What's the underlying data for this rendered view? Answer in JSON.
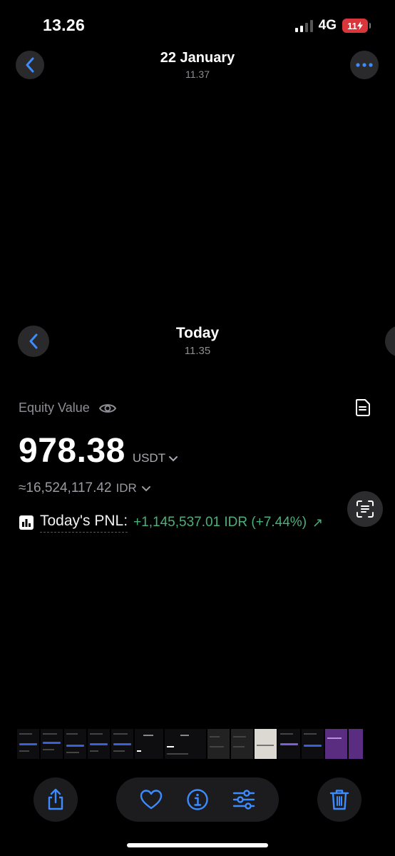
{
  "status": {
    "time": "13.26",
    "network": "4G",
    "battery": "11"
  },
  "nav": {
    "title": "22 January",
    "subtitle": "11.37"
  },
  "screenshot": {
    "title": "Today",
    "subtitle": "11.35",
    "equity_label": "Equity Value",
    "equity_value": "978.38",
    "equity_unit": "USDT",
    "idr_value": "≈16,524,117.42",
    "idr_unit": "IDR",
    "pnl_label": "Today's PNL:",
    "pnl_value": "+1,145,537.01 IDR (+7.44%)",
    "pnl_color": "#4cb07a"
  },
  "icons": {
    "back": "chevron-left-icon",
    "more": "ellipsis-icon",
    "eye": "eye-icon",
    "document": "document-icon",
    "scan": "live-text-icon",
    "share": "share-icon",
    "favorite": "heart-icon",
    "info": "info-icon",
    "adjust": "sliders-icon",
    "delete": "trash-icon"
  },
  "accent": "#3d8bfd"
}
